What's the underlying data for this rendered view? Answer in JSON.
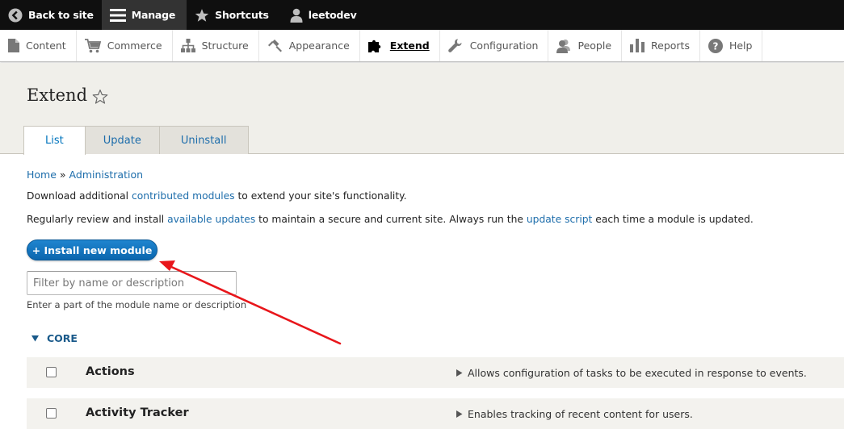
{
  "toolbar": {
    "back": "Back to site",
    "manage": "Manage",
    "shortcuts": "Shortcuts",
    "user": "leetodev"
  },
  "tray": [
    {
      "label": "Content",
      "icon": "file-icon"
    },
    {
      "label": "Commerce",
      "icon": "cart-icon"
    },
    {
      "label": "Structure",
      "icon": "sitemap-icon"
    },
    {
      "label": "Appearance",
      "icon": "paintbrush-icon"
    },
    {
      "label": "Extend",
      "icon": "puzzle-icon",
      "active": true
    },
    {
      "label": "Configuration",
      "icon": "wrench-icon"
    },
    {
      "label": "People",
      "icon": "people-icon"
    },
    {
      "label": "Reports",
      "icon": "bar-chart-icon"
    },
    {
      "label": "Help",
      "icon": "help-icon"
    }
  ],
  "page": {
    "title": "Extend",
    "tabs": [
      "List",
      "Update",
      "Uninstall"
    ],
    "active_tab": "List"
  },
  "breadcrumb": {
    "home": "Home",
    "sep": "»",
    "admin": "Administration"
  },
  "para1": {
    "pre": "Download additional ",
    "link": "contributed modules",
    "post": " to extend your site's functionality."
  },
  "para2": {
    "pre": "Regularly review and install ",
    "link1": "available updates",
    "mid": " to maintain a secure and current site. Always run the ",
    "link2": "update script",
    "post": " each time a module is updated."
  },
  "install_button": "+ Install new module",
  "filter": {
    "placeholder": "Filter by name or description",
    "help": "Enter a part of the module name or description"
  },
  "section": "CORE",
  "modules": [
    {
      "name": "Actions",
      "desc": "Allows configuration of tasks to be executed in response to events."
    },
    {
      "name": "Activity Tracker",
      "desc": "Enables tracking of recent content for users."
    }
  ],
  "colors": {
    "toolbar_bg": "#0f0f0f",
    "header_bg": "#f0efea",
    "link": "#1d6dab",
    "button": "#0b66ae",
    "annotation_arrow": "#e8161b"
  }
}
